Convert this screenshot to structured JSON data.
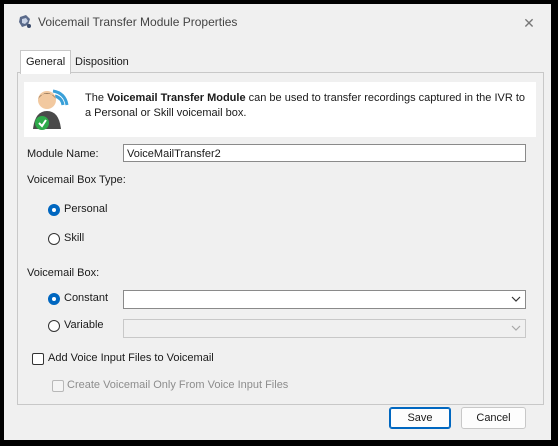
{
  "window": {
    "title": "Voicemail Transfer Module Properties",
    "close_glyph": "✕"
  },
  "tabs": [
    {
      "label": "General",
      "active": true
    },
    {
      "label": "Disposition",
      "active": false
    }
  ],
  "info": {
    "prefix": "The ",
    "bold": "Voicemail Transfer Module",
    "suffix": " can be used to transfer recordings captured in the IVR to a Personal or Skill voicemail box.",
    "icon": "voicemail-transfer-icon"
  },
  "module_name": {
    "label": "Module Name:",
    "value": "VoiceMailTransfer2"
  },
  "voicemail_box_type": {
    "label": "Voicemail Box Type:",
    "options": [
      {
        "label": "Personal",
        "checked": true
      },
      {
        "label": "Skill",
        "checked": false
      }
    ]
  },
  "voicemail_box": {
    "label": "Voicemail Box:",
    "constant": {
      "label": "Constant",
      "checked": true,
      "value": ""
    },
    "variable": {
      "label": "Variable",
      "checked": false,
      "value": ""
    }
  },
  "add_voice_input": {
    "label": "Add Voice Input Files to Voicemail",
    "checked": false
  },
  "create_only": {
    "label": "Create Voicemail Only From Voice Input Files",
    "checked": false,
    "enabled": false
  },
  "buttons": {
    "save": "Save",
    "cancel": "Cancel"
  },
  "colors": {
    "accent": "#0067c0",
    "window_bg": "#f0f0f0",
    "border": "#8a8a8a"
  }
}
